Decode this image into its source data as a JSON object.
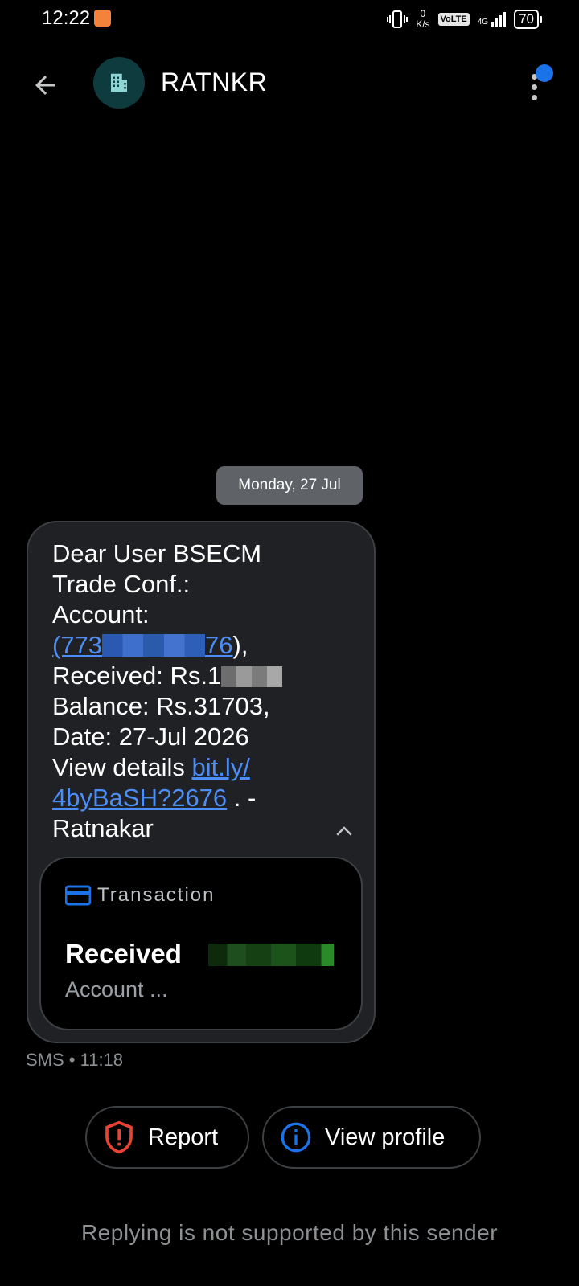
{
  "status_bar": {
    "time": "12:22",
    "net_speed_value": "0",
    "net_speed_unit": "K/s",
    "volte": "VoLTE",
    "network": "4G",
    "battery": "70"
  },
  "header": {
    "sender": "RATNKR",
    "avatar_icon": "building-icon",
    "back_icon": "back-arrow-icon",
    "menu_icon": "more-vert-icon"
  },
  "thread": {
    "date_chip": "Monday, 27 Jul",
    "message": {
      "line1": "Dear User BSECM",
      "line2": "Trade Conf.:",
      "line3": "Account:",
      "account_prefix": "(773",
      "account_suffix": "76",
      "account_close": "),",
      "received_label": "Received: Rs.1",
      "balance": "Balance: Rs.31703,",
      "date": "Date: 27-Jul 2026",
      "view_details": "View details",
      "link_part1": "bit.ly/",
      "link_part2": "4byBaSH?2676",
      "tail": " . -",
      "signature": "Ratnakar"
    },
    "transaction_card": {
      "header": "Transaction",
      "title": "Received",
      "subtitle": "Account ..."
    },
    "meta": "SMS • 11:18"
  },
  "actions": {
    "report_label": "Report",
    "view_profile_label": "View profile"
  },
  "footer_note": "Replying is not supported by this sender",
  "colors": {
    "accent_blue": "#4c8df6",
    "report_red": "#ea4335",
    "bubble_bg": "#202124",
    "badge": "#1a73e8"
  }
}
